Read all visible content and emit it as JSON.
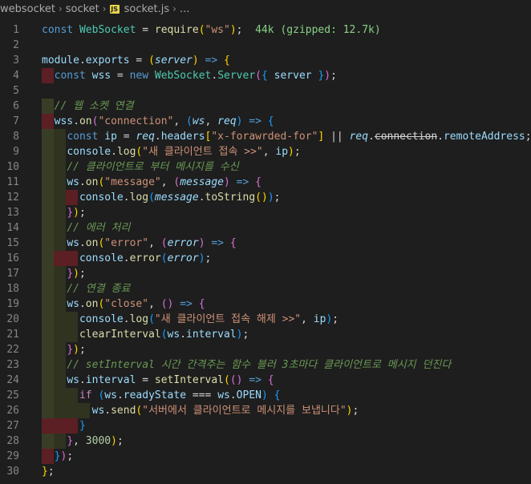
{
  "breadcrumb": {
    "items": [
      "websocket",
      "socket",
      "socket.js",
      "..."
    ],
    "file_icon": "JS"
  },
  "editor": {
    "language": "javascript",
    "lines": [
      {
        "n": "1",
        "spans": [
          [
            "kw",
            "const "
          ],
          [
            "cls",
            "WebSocket"
          ],
          [
            "pun",
            " = "
          ],
          [
            "fn",
            "require"
          ],
          [
            "brk1",
            "("
          ],
          [
            "str",
            "\"ws\""
          ],
          [
            "brk1",
            ")"
          ],
          [
            "pun",
            ";"
          ],
          [
            "hint",
            "  44k (gzipped: 12.7k)"
          ]
        ]
      },
      {
        "n": "2",
        "spans": []
      },
      {
        "n": "3",
        "spans": [
          [
            "var",
            "module"
          ],
          [
            "pun",
            "."
          ],
          [
            "var",
            "exports"
          ],
          [
            "pun",
            " = "
          ],
          [
            "brk1",
            "("
          ],
          [
            "prm",
            "server"
          ],
          [
            "brk1",
            ")"
          ],
          [
            "kw",
            " =>"
          ],
          [
            "pun",
            " "
          ],
          [
            "brk1",
            "{"
          ]
        ]
      },
      {
        "n": "4",
        "spans": [
          [
            "pun",
            "  "
          ],
          [
            "kw",
            "const "
          ],
          [
            "var",
            "wss"
          ],
          [
            "pun",
            " = "
          ],
          [
            "kw",
            "new "
          ],
          [
            "cls",
            "WebSocket"
          ],
          [
            "pun",
            "."
          ],
          [
            "cls",
            "Server"
          ],
          [
            "brk2",
            "("
          ],
          [
            "brk3",
            "{"
          ],
          [
            "pun",
            " "
          ],
          [
            "var",
            "server"
          ],
          [
            "pun",
            " "
          ],
          [
            "brk3",
            "}"
          ],
          [
            "brk2",
            ")"
          ],
          [
            "pun",
            ";"
          ]
        ]
      },
      {
        "n": "5",
        "spans": []
      },
      {
        "n": "6",
        "spans": [
          [
            "pun",
            "  "
          ],
          [
            "cmt",
            "// 웹 소켓 연결"
          ]
        ]
      },
      {
        "n": "7",
        "spans": [
          [
            "pun",
            "  "
          ],
          [
            "var",
            "wss"
          ],
          [
            "pun",
            "."
          ],
          [
            "fn",
            "on"
          ],
          [
            "brk2",
            "("
          ],
          [
            "str",
            "\"connection\""
          ],
          [
            "pun",
            ", "
          ],
          [
            "brk3",
            "("
          ],
          [
            "prm",
            "ws"
          ],
          [
            "pun",
            ", "
          ],
          [
            "prm",
            "req"
          ],
          [
            "brk3",
            ")"
          ],
          [
            "kw",
            " =>"
          ],
          [
            "pun",
            " "
          ],
          [
            "brk3",
            "{"
          ]
        ]
      },
      {
        "n": "8",
        "spans": [
          [
            "pun",
            "    "
          ],
          [
            "kw",
            "const "
          ],
          [
            "var",
            "ip"
          ],
          [
            "pun",
            " = "
          ],
          [
            "prm",
            "req"
          ],
          [
            "pun",
            "."
          ],
          [
            "var",
            "headers"
          ],
          [
            "brk1",
            "["
          ],
          [
            "str",
            "\"x-forawrded-for\""
          ],
          [
            "brk1",
            "]"
          ],
          [
            "pun",
            " || "
          ],
          [
            "prm",
            "req"
          ],
          [
            "pun",
            "."
          ],
          [
            "dep",
            "connection"
          ],
          [
            "pun",
            "."
          ],
          [
            "var",
            "remoteAddress"
          ],
          [
            "pun",
            ";"
          ]
        ]
      },
      {
        "n": "9",
        "spans": [
          [
            "pun",
            "    "
          ],
          [
            "var",
            "console"
          ],
          [
            "pun",
            "."
          ],
          [
            "fn",
            "log"
          ],
          [
            "brk1",
            "("
          ],
          [
            "str",
            "\"새 클라이언트 접속 >>\""
          ],
          [
            "pun",
            ", "
          ],
          [
            "var",
            "ip"
          ],
          [
            "brk1",
            ")"
          ],
          [
            "pun",
            ";"
          ]
        ]
      },
      {
        "n": "10",
        "spans": [
          [
            "pun",
            "    "
          ],
          [
            "cmt",
            "// 클라이언트로 부터 메시지를 수신"
          ]
        ]
      },
      {
        "n": "11",
        "spans": [
          [
            "pun",
            "    "
          ],
          [
            "var",
            "ws"
          ],
          [
            "pun",
            "."
          ],
          [
            "fn",
            "on"
          ],
          [
            "brk1",
            "("
          ],
          [
            "str",
            "\"message\""
          ],
          [
            "pun",
            ", "
          ],
          [
            "brk2",
            "("
          ],
          [
            "prm",
            "message"
          ],
          [
            "brk2",
            ")"
          ],
          [
            "kw",
            " =>"
          ],
          [
            "pun",
            " "
          ],
          [
            "brk2",
            "{"
          ]
        ]
      },
      {
        "n": "12",
        "spans": [
          [
            "pun",
            "      "
          ],
          [
            "var",
            "console"
          ],
          [
            "pun",
            "."
          ],
          [
            "fn",
            "log"
          ],
          [
            "brk3",
            "("
          ],
          [
            "prm",
            "message"
          ],
          [
            "pun",
            "."
          ],
          [
            "fn",
            "toString"
          ],
          [
            "brk1",
            "()"
          ],
          [
            "brk3",
            ")"
          ],
          [
            "pun",
            ";"
          ]
        ]
      },
      {
        "n": "13",
        "spans": [
          [
            "pun",
            "    "
          ],
          [
            "brk2",
            "}"
          ],
          [
            "brk1",
            ")"
          ],
          [
            "pun",
            ";"
          ]
        ]
      },
      {
        "n": "14",
        "spans": [
          [
            "pun",
            "    "
          ],
          [
            "cmt",
            "// 에러 처리"
          ]
        ]
      },
      {
        "n": "15",
        "spans": [
          [
            "pun",
            "    "
          ],
          [
            "var",
            "ws"
          ],
          [
            "pun",
            "."
          ],
          [
            "fn",
            "on"
          ],
          [
            "brk1",
            "("
          ],
          [
            "str",
            "\"error\""
          ],
          [
            "pun",
            ", "
          ],
          [
            "brk2",
            "("
          ],
          [
            "prm",
            "error"
          ],
          [
            "brk2",
            ")"
          ],
          [
            "kw",
            " =>"
          ],
          [
            "pun",
            " "
          ],
          [
            "brk2",
            "{"
          ]
        ]
      },
      {
        "n": "16",
        "spans": [
          [
            "pun",
            "      "
          ],
          [
            "var",
            "console"
          ],
          [
            "pun",
            "."
          ],
          [
            "fn",
            "error"
          ],
          [
            "brk3",
            "("
          ],
          [
            "prm",
            "error"
          ],
          [
            "brk3",
            ")"
          ],
          [
            "pun",
            ";"
          ]
        ]
      },
      {
        "n": "17",
        "spans": [
          [
            "pun",
            "    "
          ],
          [
            "brk2",
            "}"
          ],
          [
            "brk1",
            ")"
          ],
          [
            "pun",
            ";"
          ]
        ]
      },
      {
        "n": "18",
        "spans": [
          [
            "pun",
            "    "
          ],
          [
            "cmt",
            "// 연결 종료"
          ]
        ]
      },
      {
        "n": "19",
        "spans": [
          [
            "pun",
            "    "
          ],
          [
            "var",
            "ws"
          ],
          [
            "pun",
            "."
          ],
          [
            "fn",
            "on"
          ],
          [
            "brk1",
            "("
          ],
          [
            "str",
            "\"close\""
          ],
          [
            "pun",
            ", "
          ],
          [
            "brk2",
            "()"
          ],
          [
            "kw",
            " =>"
          ],
          [
            "pun",
            " "
          ],
          [
            "brk2",
            "{"
          ]
        ]
      },
      {
        "n": "20",
        "spans": [
          [
            "pun",
            "      "
          ],
          [
            "var",
            "console"
          ],
          [
            "pun",
            "."
          ],
          [
            "fn",
            "log"
          ],
          [
            "brk3",
            "("
          ],
          [
            "str",
            "\"새 클라이언트 접속 해제 >>\""
          ],
          [
            "pun",
            ", "
          ],
          [
            "var",
            "ip"
          ],
          [
            "brk3",
            ")"
          ],
          [
            "pun",
            ";"
          ]
        ]
      },
      {
        "n": "21",
        "spans": [
          [
            "pun",
            "      "
          ],
          [
            "fn",
            "clearInterval"
          ],
          [
            "brk3",
            "("
          ],
          [
            "var",
            "ws"
          ],
          [
            "pun",
            "."
          ],
          [
            "var",
            "interval"
          ],
          [
            "brk3",
            ")"
          ],
          [
            "pun",
            ";"
          ]
        ]
      },
      {
        "n": "22",
        "spans": [
          [
            "pun",
            "    "
          ],
          [
            "brk2",
            "}"
          ],
          [
            "brk1",
            ")"
          ],
          [
            "pun",
            ";"
          ]
        ]
      },
      {
        "n": "23",
        "spans": [
          [
            "pun",
            "    "
          ],
          [
            "cmt",
            "// setInterval 시간 간격주는 함수 블러 3초마다 클라이언트로 메시지 던진다"
          ]
        ]
      },
      {
        "n": "24",
        "spans": [
          [
            "pun",
            "    "
          ],
          [
            "var",
            "ws"
          ],
          [
            "pun",
            "."
          ],
          [
            "var",
            "interval"
          ],
          [
            "pun",
            " = "
          ],
          [
            "fn",
            "setInterval"
          ],
          [
            "brk1",
            "("
          ],
          [
            "brk2",
            "()"
          ],
          [
            "kw",
            " =>"
          ],
          [
            "pun",
            " "
          ],
          [
            "brk2",
            "{"
          ]
        ]
      },
      {
        "n": "25",
        "spans": [
          [
            "pun",
            "      "
          ],
          [
            "ctl",
            "if "
          ],
          [
            "brk3",
            "("
          ],
          [
            "var",
            "ws"
          ],
          [
            "pun",
            "."
          ],
          [
            "var",
            "readyState"
          ],
          [
            "pun",
            " === "
          ],
          [
            "var",
            "ws"
          ],
          [
            "pun",
            "."
          ],
          [
            "var",
            "OPEN"
          ],
          [
            "brk3",
            ")"
          ],
          [
            "pun",
            " "
          ],
          [
            "brk3",
            "{"
          ]
        ]
      },
      {
        "n": "26",
        "spans": [
          [
            "pun",
            "        "
          ],
          [
            "var",
            "ws"
          ],
          [
            "pun",
            "."
          ],
          [
            "fn",
            "send"
          ],
          [
            "brk1",
            "("
          ],
          [
            "str",
            "\"서버에서 클라이언트로 메시지를 보냅니다\""
          ],
          [
            "brk1",
            ")"
          ],
          [
            "pun",
            ";"
          ]
        ]
      },
      {
        "n": "27",
        "spans": [
          [
            "pun",
            "      "
          ],
          [
            "brk3",
            "}"
          ]
        ]
      },
      {
        "n": "28",
        "spans": [
          [
            "pun",
            "    "
          ],
          [
            "brk2",
            "}"
          ],
          [
            "pun",
            ", "
          ],
          [
            "num",
            "3000"
          ],
          [
            "brk1",
            ")"
          ],
          [
            "pun",
            ";"
          ]
        ]
      },
      {
        "n": "29",
        "spans": [
          [
            "pun",
            "  "
          ],
          [
            "brk3",
            "}"
          ],
          [
            "brk2",
            ")"
          ],
          [
            "pun",
            ";"
          ]
        ]
      },
      {
        "n": "30",
        "spans": [
          [
            "brk1",
            "}"
          ],
          [
            "pun",
            ";"
          ]
        ]
      }
    ]
  },
  "theme": {
    "background": "#1e1e1e",
    "line_number": "#858585",
    "indent_error": "#5c1f24",
    "indent_olive": "#3a3d25"
  }
}
